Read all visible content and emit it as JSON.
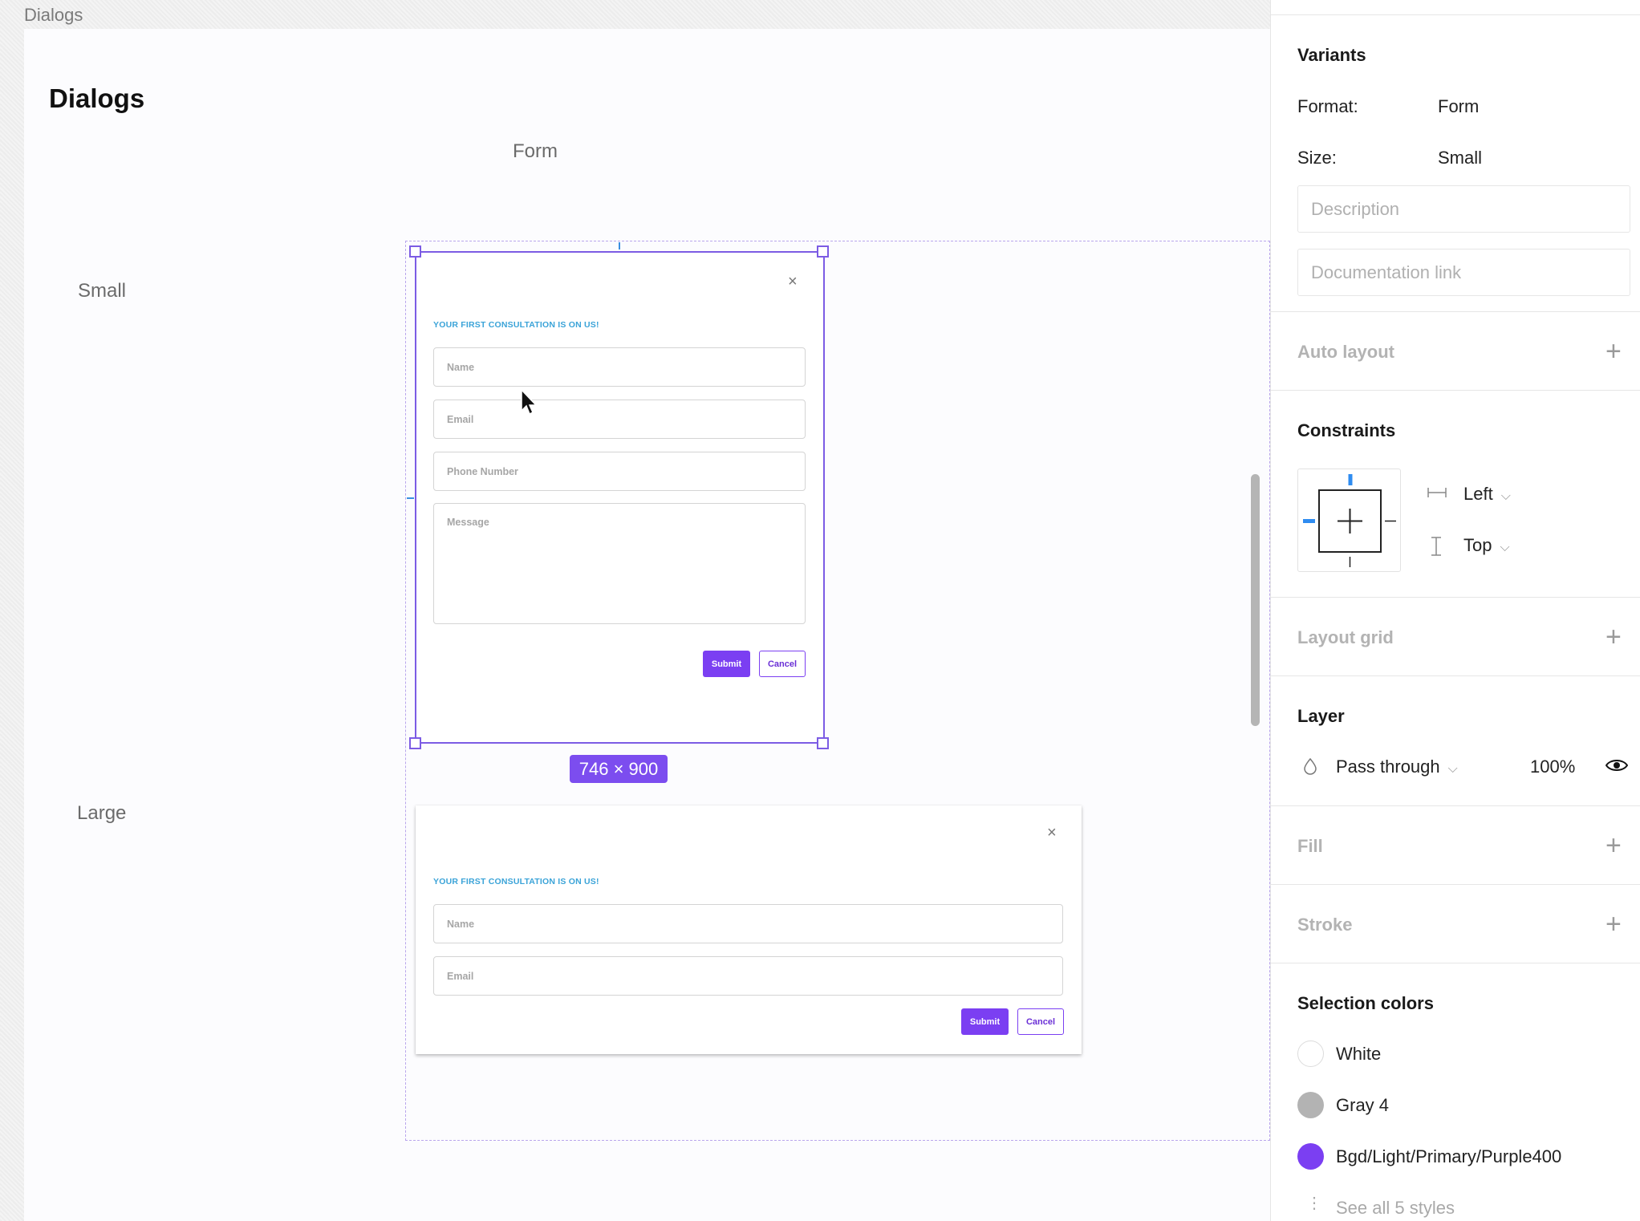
{
  "canvas": {
    "frame_label": "Dialogs",
    "page_title": "Dialogs",
    "column_label": "Form",
    "row_labels": {
      "small": "Small",
      "large": "Large"
    },
    "dimension_badge": "746 × 900"
  },
  "dialog_small": {
    "close": "×",
    "heading": "YOUR FIRST CONSULTATION IS ON US!",
    "name_placeholder": "Name",
    "email_placeholder": "Email",
    "phone_placeholder": "Phone Number",
    "message_placeholder": "Message",
    "submit": "Submit",
    "cancel": "Cancel"
  },
  "dialog_large": {
    "close": "×",
    "heading": "YOUR FIRST CONSULTATION IS ON US!",
    "name_placeholder": "Name",
    "email_placeholder": "Email",
    "submit": "Submit",
    "cancel": "Cancel"
  },
  "panel": {
    "variants": {
      "title": "Variants",
      "format_label": "Format:",
      "format_value": "Form",
      "size_label": "Size:",
      "size_value": "Small",
      "description_placeholder": "Description",
      "doc_link_placeholder": "Documentation link"
    },
    "auto_layout": "Auto layout",
    "constraints": {
      "title": "Constraints",
      "horizontal": "Left",
      "vertical": "Top"
    },
    "layout_grid": "Layout grid",
    "layer": {
      "title": "Layer",
      "blend_mode": "Pass through",
      "opacity": "100%"
    },
    "fill": "Fill",
    "stroke": "Stroke",
    "selection_colors": {
      "title": "Selection colors",
      "items": [
        {
          "name": "White",
          "color": "#ffffff"
        },
        {
          "name": "Gray 4",
          "color": "#b3b3b3"
        },
        {
          "name": "Bgd/Light/Primary/Purple400",
          "color": "#7b3ff2"
        }
      ],
      "see_all": "See all 5 styles"
    }
  },
  "colors": {
    "accent_purple": "#7b3ff2",
    "heading_blue": "#3aa3d8",
    "selection": "#7c5ce4",
    "constraint_blue": "#2f8cf0"
  }
}
